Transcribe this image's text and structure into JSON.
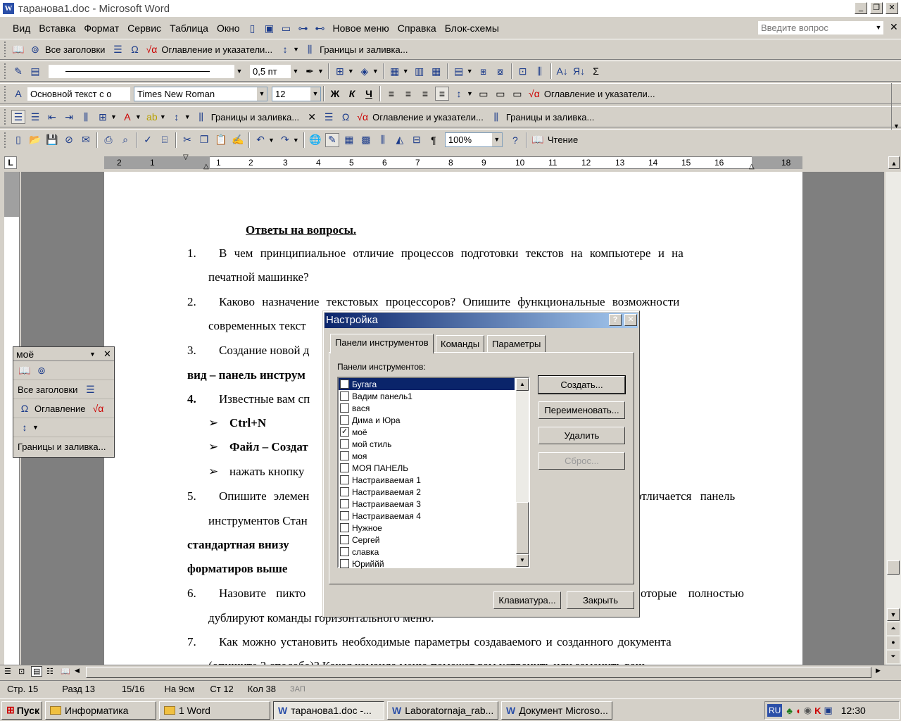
{
  "window": {
    "title": "таранова1.doc - Microsoft Word"
  },
  "menu": {
    "items": [
      "Вид",
      "Вставка",
      "Формат",
      "Сервис",
      "Таблица",
      "Окно"
    ],
    "extra": [
      "Новое меню",
      "Справка",
      "Блок-схемы"
    ],
    "help_placeholder": "Введите вопрос"
  },
  "toolbar1": {
    "headings": "Все заголовки",
    "toc": "Оглавление и указатели...",
    "borders": "Границы и заливка..."
  },
  "toolbar2": {
    "line_width": "0,5 пт"
  },
  "toolbar3": {
    "style": "Основной текст с о",
    "font": "Times New Roman",
    "size": "12",
    "bold": "Ж",
    "italic": "К",
    "underline": "Ч",
    "toc": "Оглавление и указатели..."
  },
  "toolbar4": {
    "borders1": "Границы и заливка...",
    "toc": "Оглавление и указатели...",
    "borders2": "Границы и заливка..."
  },
  "toolbar5": {
    "zoom": "100%",
    "read": "Чтение"
  },
  "ruler": {
    "ticks": [
      "2",
      "1",
      "1",
      "2",
      "3",
      "4",
      "5",
      "6",
      "7",
      "8",
      "9",
      "10",
      "11",
      "12",
      "13",
      "14",
      "15",
      "16",
      "18"
    ]
  },
  "document": {
    "heading": "Ответы на вопросы.",
    "l1a": "1.",
    "l1b": "В чем принципиальное отличие процессов подготовки текстов на компьютере и на",
    "l1c": "печатной машинке?",
    "l2a": "2.",
    "l2b": "Каково назначение текстовых процессоров? Опишите функциональные возможности",
    "l2c": "современных текст",
    "l3a": "3.",
    "l3b": "Создание новой д",
    "l3c": "вид – панель инструм",
    "l4a": "4.",
    "l4b": "Известные вам сп",
    "b1": "Ctrl+N",
    "b2": "Файл – Создат",
    "b3": "нажать кнопку",
    "l5a": "5.",
    "l5b": "Опишите элемен",
    "l5c": "отличается панель",
    "l5d": "инструментов Стан",
    "l5e": "стандартная внизу",
    "l5f": "форматиров выше",
    "l6a": "6.",
    "l6b": "Назовите пикто",
    "l6c": "оторые полностью",
    "l6d": "дублируют команды горизонтального меню.",
    "l7a": "7.",
    "l7b": "Как можно установить необходимые параметры создаваемого и созданного документа",
    "l7c": "(опишите 2 способа)? Какая команда меню поможет вам устранить или заменить ваш"
  },
  "float": {
    "title": "моё",
    "headings": "Все заголовки",
    "toc": "Оглавление",
    "borders": "Границы и заливка..."
  },
  "dialog": {
    "title": "Настройка",
    "tabs": [
      "Панели инструментов",
      "Команды",
      "Параметры"
    ],
    "list_label": "Панели инструментов:",
    "items": [
      {
        "label": "Бугага",
        "checked": false
      },
      {
        "label": "Вадим панель1",
        "checked": false
      },
      {
        "label": "вася",
        "checked": false
      },
      {
        "label": "Дима и Юра",
        "checked": false
      },
      {
        "label": "моё",
        "checked": true
      },
      {
        "label": "мой стиль",
        "checked": false
      },
      {
        "label": "моя",
        "checked": false
      },
      {
        "label": "МОЯ ПАНЕЛЬ",
        "checked": false
      },
      {
        "label": "Настраиваемая 1",
        "checked": false
      },
      {
        "label": "Настраиваемая 2",
        "checked": false
      },
      {
        "label": "Настраиваемая 3",
        "checked": false
      },
      {
        "label": "Настраиваемая 4",
        "checked": false
      },
      {
        "label": "Нужное",
        "checked": false
      },
      {
        "label": "Сергей",
        "checked": false
      },
      {
        "label": "славка",
        "checked": false
      },
      {
        "label": "Юриййй",
        "checked": false
      }
    ],
    "create": "Создать...",
    "rename": "Переименовать...",
    "delete": "Удалить",
    "reset": "Сброс...",
    "keyboard": "Клавиатура...",
    "close": "Закрыть"
  },
  "status": {
    "page": "Стр. 15",
    "section": "Разд 13",
    "pages": "15/16",
    "at": "На 9см",
    "line": "Ст 12",
    "col": "Кол 38",
    "rec": "ЗАП"
  },
  "taskbar": {
    "start": "Пуск",
    "tasks": [
      "Информатика",
      "1 Word",
      "таранова1.doc -...",
      "Laboratornaja_rab...",
      "Документ Microso..."
    ],
    "lang": "RU",
    "time": "12:30"
  }
}
